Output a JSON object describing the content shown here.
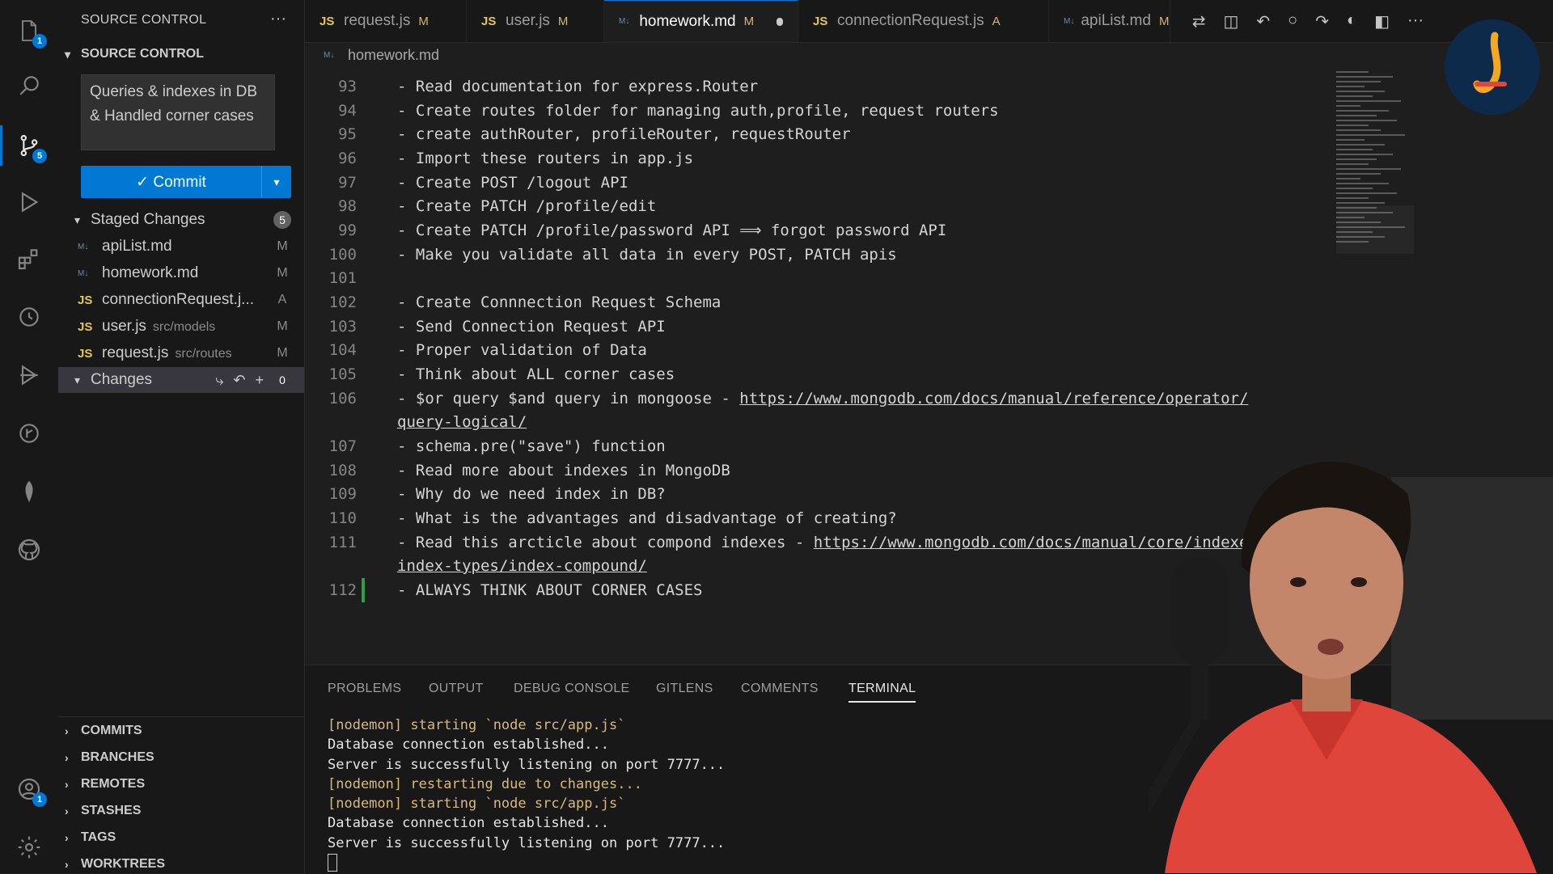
{
  "activity_bar": {
    "icons": [
      "explorer-icon",
      "search-icon",
      "source-control-icon",
      "run-debug-icon",
      "extensions-icon",
      "remote-explorer-icon",
      "testing-icon",
      "git-graph-icon",
      "mongodb-icon",
      "github-icon"
    ],
    "explorer_badge": "1",
    "source_control_badge": "5",
    "accounts_badge": "1"
  },
  "sidebar": {
    "title": "SOURCE CONTROL",
    "more": "···",
    "section": "SOURCE CONTROL",
    "commit_message": "Queries & indexes in DB & Handled corner cases",
    "commit_label": "✓ Commit",
    "staged": {
      "label": "Staged Changes",
      "count": "5"
    },
    "files": [
      {
        "type": "md",
        "name": "apiList.md",
        "path": "",
        "status": "M"
      },
      {
        "type": "md",
        "name": "homework.md",
        "path": "",
        "status": "M"
      },
      {
        "type": "js",
        "name": "connectionRequest.j...",
        "path": "",
        "status": "A"
      },
      {
        "type": "js",
        "name": "user.js",
        "path": "src/models",
        "status": "M"
      },
      {
        "type": "js",
        "name": "request.js",
        "path": "src/routes",
        "status": "M"
      }
    ],
    "changes": {
      "label": "Changes",
      "count": "0"
    },
    "bottom_sections": [
      "COMMITS",
      "BRANCHES",
      "REMOTES",
      "STASHES",
      "TAGS",
      "WORKTREES"
    ]
  },
  "tabs": [
    {
      "icon": "JS",
      "name": "request.js",
      "mark": "M",
      "active": false
    },
    {
      "icon": "JS",
      "name": "user.js",
      "mark": "M",
      "active": false
    },
    {
      "icon": "MD",
      "name": "homework.md",
      "mark": "M",
      "active": true
    },
    {
      "icon": "JS",
      "name": "connectionRequest.js",
      "mark": "A",
      "active": false
    },
    {
      "icon": "MD",
      "name": "apiList.md",
      "mark": "M",
      "active": false
    }
  ],
  "breadcrumb": "homework.md",
  "editor": {
    "lines": [
      {
        "n": "93",
        "text": "- Read documentation for express.Router"
      },
      {
        "n": "94",
        "text": "- Create routes folder for managing auth,profile, request routers"
      },
      {
        "n": "95",
        "text": "- create authRouter, profileRouter, requestRouter"
      },
      {
        "n": "96",
        "text": "- Import these routers in app.js"
      },
      {
        "n": "97",
        "text": "- Create POST /logout API"
      },
      {
        "n": "98",
        "text": "- Create PATCH /profile/edit"
      },
      {
        "n": "99",
        "text": "- Create PATCH /profile/password API ⟹ forgot password API"
      },
      {
        "n": "100",
        "text": "- Make you validate all data in every POST, PATCH apis"
      },
      {
        "n": "101",
        "text": ""
      },
      {
        "n": "102",
        "text": "- Create Connnection Request Schema"
      },
      {
        "n": "103",
        "text": "- Send Connection Request API"
      },
      {
        "n": "104",
        "text": "- Proper validation of Data"
      },
      {
        "n": "105",
        "text": "- Think about ALL corner cases"
      },
      {
        "n": "106",
        "text": "- $or query $and query in mongoose - ",
        "link": "https://www.mongodb.com/docs/manual/reference/operator/",
        "wrap": "query-logical/"
      },
      {
        "n": "107",
        "text": "- schema.pre(\"save\") function"
      },
      {
        "n": "108",
        "text": "- Read more about indexes in MongoDB"
      },
      {
        "n": "109",
        "text": "- Why do we need index in DB?"
      },
      {
        "n": "110",
        "text": "- What is the advantages and disadvantage of creating?"
      },
      {
        "n": "111",
        "text": "- Read this arcticle about compond indexes - ",
        "link": "https://www.mongodb.com/docs/manual/core/indexe",
        "wrap": "index-types/index-compound/"
      },
      {
        "n": "112",
        "text": "- ALWAYS THINK ABOUT CORNER CASES"
      }
    ]
  },
  "panel": {
    "tabs": [
      "PROBLEMS",
      "OUTPUT",
      "DEBUG CONSOLE",
      "GITLENS",
      "COMMENTS",
      "TERMINAL"
    ],
    "active_tab": "TERMINAL",
    "terminal": [
      {
        "cls": "yellow",
        "text": "[nodemon] starting `node src/app.js`"
      },
      {
        "cls": "white",
        "text": "Database connection established..."
      },
      {
        "cls": "white",
        "text": "Server is successfully listening on port 7777..."
      },
      {
        "cls": "yellow",
        "text": "[nodemon] restarting due to changes..."
      },
      {
        "cls": "yellow",
        "text": "[nodemon] starting `node src/app.js`"
      },
      {
        "cls": "white",
        "text": "Database connection established..."
      },
      {
        "cls": "white",
        "text": "Server is successfully listening on port 7777..."
      }
    ]
  },
  "colors": {
    "accent": "#0078d4",
    "terminal_yellow": "#d7ba7d",
    "webcam_shirt": "#e0453c"
  }
}
